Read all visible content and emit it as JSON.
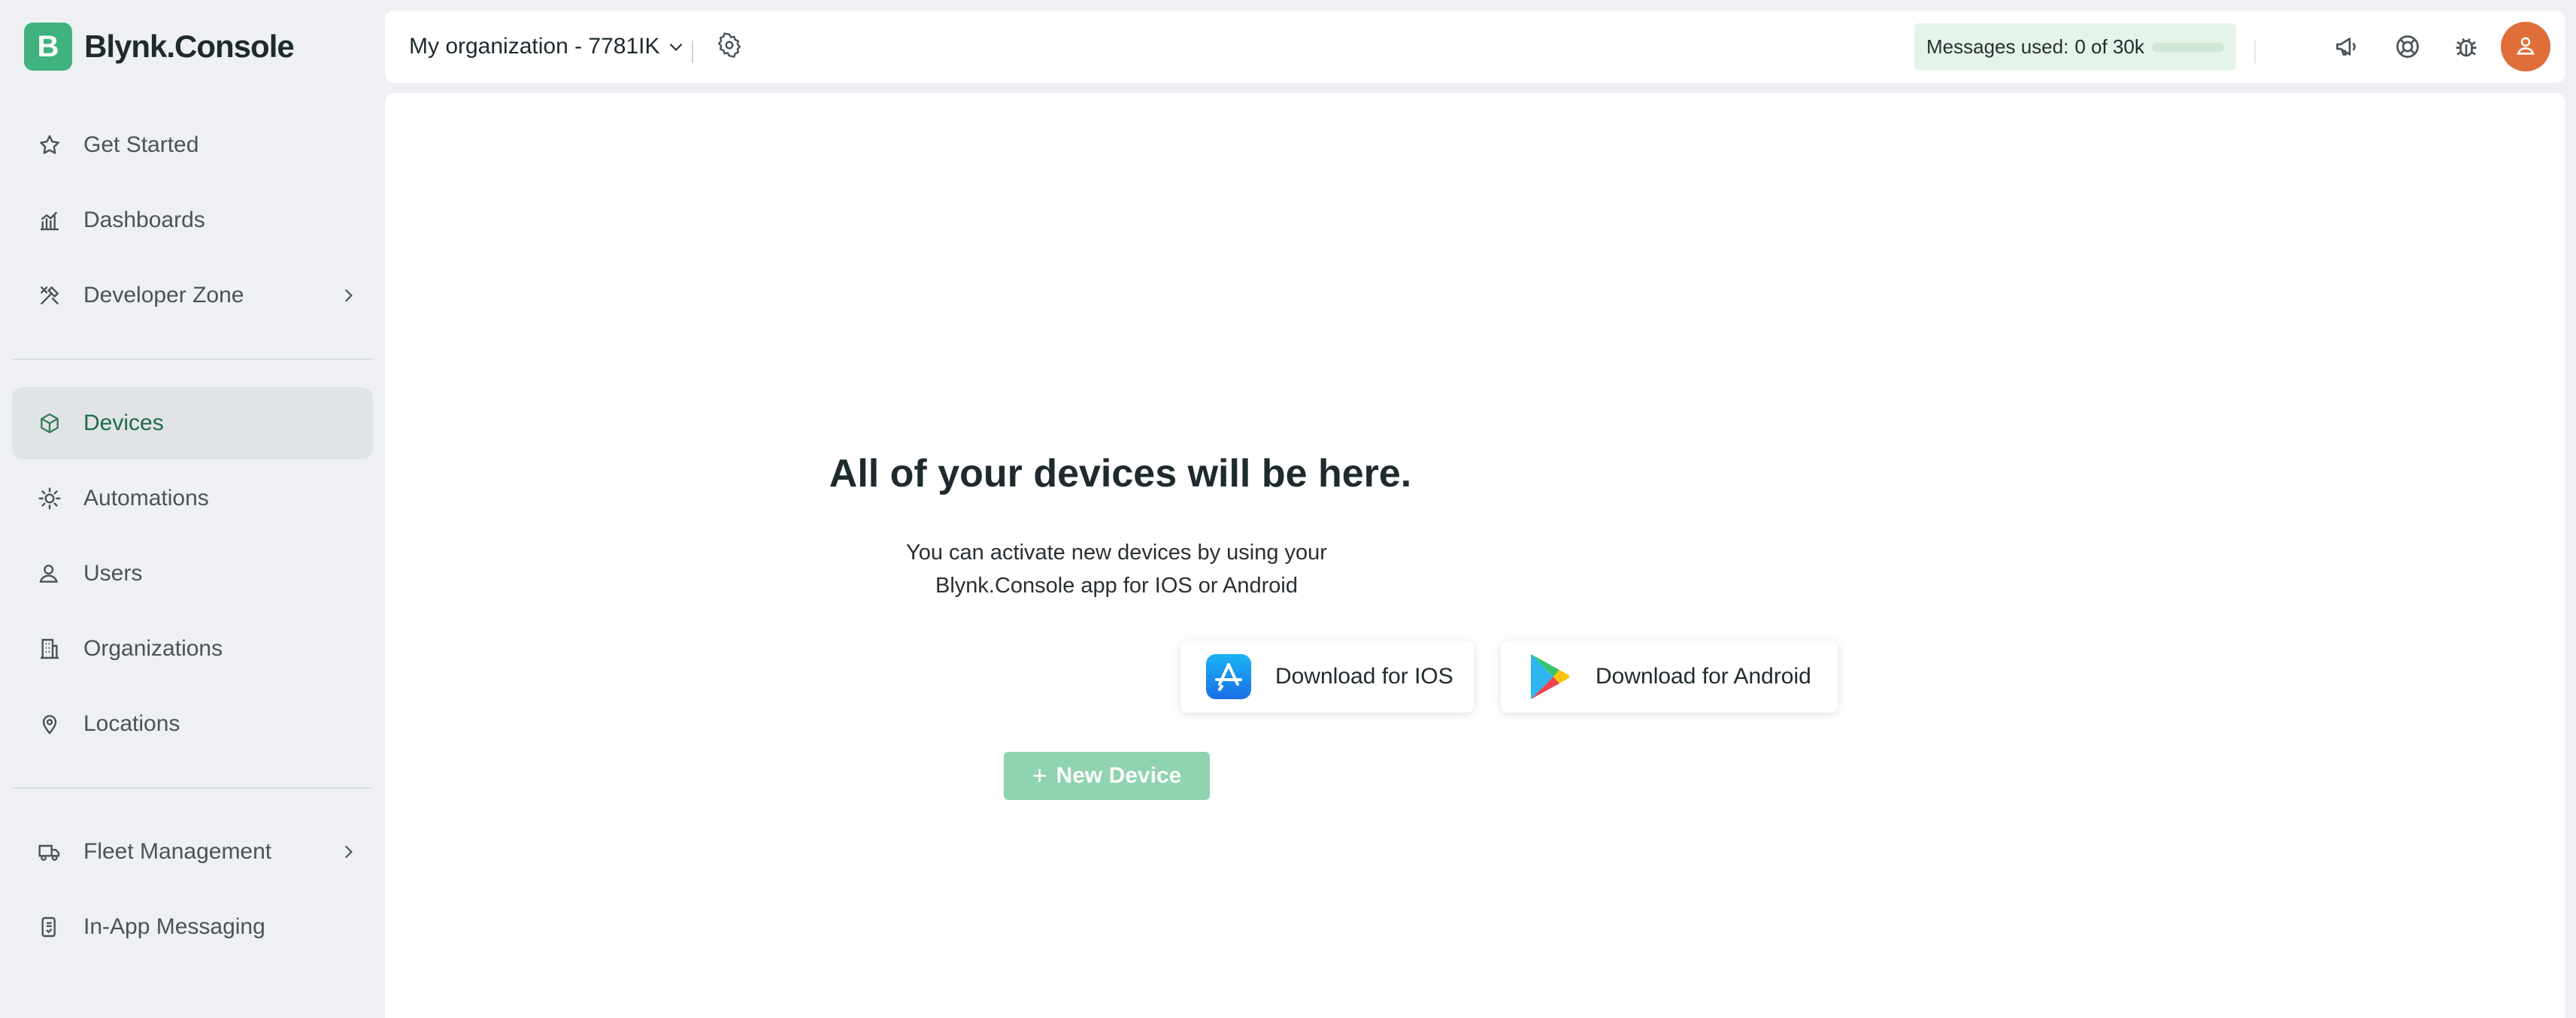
{
  "brand": {
    "logo_letter": "B",
    "name": "Blynk.Console"
  },
  "sidebar": {
    "items": [
      {
        "label": "Get Started",
        "icon": "star-icon"
      },
      {
        "label": "Dashboards",
        "icon": "chart-icon"
      },
      {
        "label": "Developer Zone",
        "icon": "tools-icon",
        "has_submenu": true
      },
      {
        "label": "Devices",
        "icon": "cube-icon",
        "active": true
      },
      {
        "label": "Automations",
        "icon": "automation-icon"
      },
      {
        "label": "Users",
        "icon": "users-icon"
      },
      {
        "label": "Organizations",
        "icon": "building-icon"
      },
      {
        "label": "Locations",
        "icon": "location-pin-icon"
      },
      {
        "label": "Fleet Management",
        "icon": "truck-icon",
        "has_submenu": true
      },
      {
        "label": "In-App Messaging",
        "icon": "messaging-icon"
      }
    ]
  },
  "header": {
    "org_label": "My organization - 7781IK",
    "messages_label": "Messages used:",
    "messages_count": "0 of 30k",
    "messages_used_fraction": 0,
    "icons": [
      "megaphone-icon",
      "help-lifebuoy-icon",
      "bug-icon",
      "avatar"
    ]
  },
  "main": {
    "empty_title": "All of your devices will be here.",
    "empty_line1": "You can activate new devices by using your",
    "empty_line2": "Blynk.Console app for IOS or Android",
    "ios_button": "Download for IOS",
    "android_button": "Download for Android",
    "new_device_plus": "+",
    "new_device_button": "New Device"
  },
  "colors": {
    "brand_green": "#3fb27f",
    "active_text": "#1e6b49",
    "new_device_bg": "#8fd3b0",
    "avatar_bg": "#e06e3a",
    "messages_bg": "#e4f4e8"
  }
}
